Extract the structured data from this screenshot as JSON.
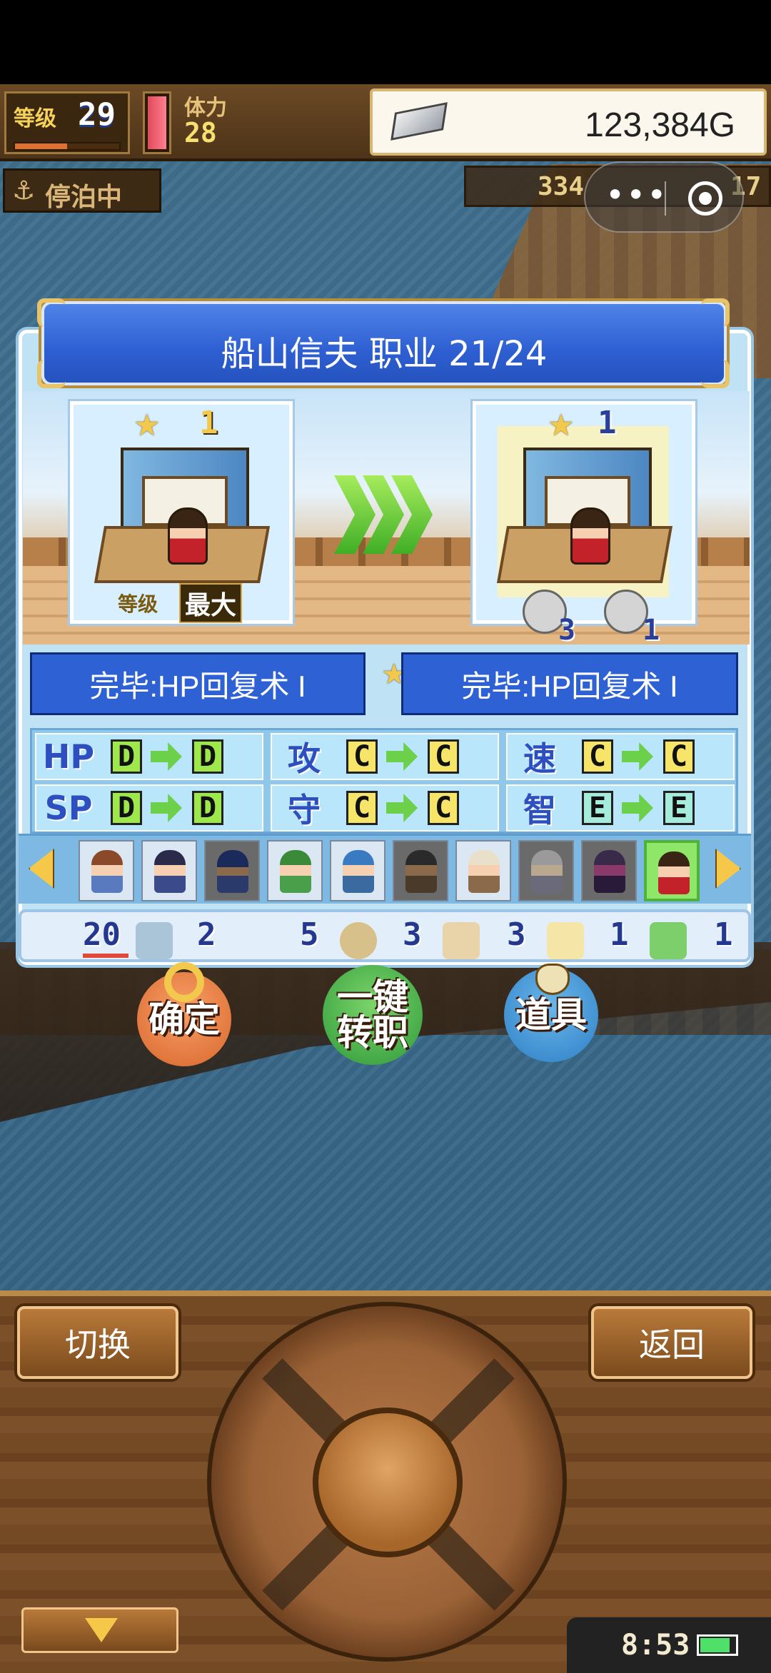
{
  "hud": {
    "level_label": "等级",
    "level_value": "29",
    "level_exp_fraction": 0.5,
    "stamina_label": "体力",
    "stamina_value": "28",
    "gold_value": "123,384G",
    "status_label": "停泊中",
    "resource_a": "334",
    "resource_b": "17"
  },
  "dialog": {
    "title": "船山信夫  职业 21/24",
    "current": {
      "rank": "1",
      "level_label": "等级",
      "level_value": "最大"
    },
    "next": {
      "rank": "1",
      "tool_anchor_count": "3",
      "tool_saw_count": "1"
    },
    "skill_current": "完毕:HP回复术 I",
    "skill_next": "完毕:HP回复术 I"
  },
  "stats": [
    {
      "name": "HP",
      "from": "D",
      "to": "D"
    },
    {
      "name": "攻",
      "from": "C",
      "to": "C"
    },
    {
      "name": "速",
      "from": "C",
      "to": "C"
    },
    {
      "name": "SP",
      "from": "D",
      "to": "D"
    },
    {
      "name": "守",
      "from": "C",
      "to": "C"
    },
    {
      "name": "智",
      "from": "E",
      "to": "E"
    }
  ],
  "tools": [
    {
      "icon": "wrench-icon",
      "count": "20"
    },
    {
      "icon": "hammer-icon",
      "count": "2"
    },
    {
      "icon": "magnifier-icon",
      "count": "5"
    },
    {
      "icon": "fist-icon",
      "count": "3"
    },
    {
      "icon": "lamp-icon",
      "count": "3"
    },
    {
      "icon": "saw-icon",
      "count": "1"
    },
    {
      "icon": "extra-icon",
      "count": "1"
    }
  ],
  "buttons": {
    "confirm": "确定",
    "one_click": "一键转职",
    "items": "道具",
    "switch": "切换",
    "back": "返回"
  },
  "system": {
    "time": "8:53",
    "battery_fraction": 0.85
  },
  "colors": {
    "panel_blue": "#2e61d4",
    "grade_D": "#9ee84c",
    "grade_C": "#f7e56a",
    "grade_E": "#a6ecdd"
  }
}
